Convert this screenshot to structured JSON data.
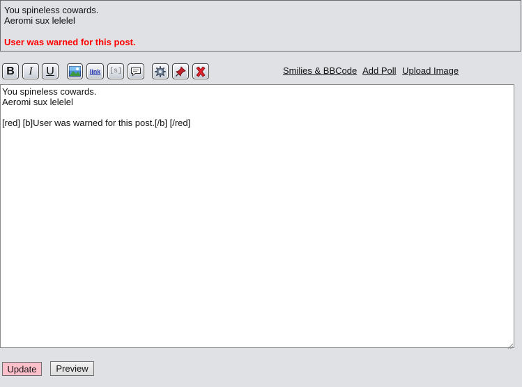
{
  "preview": {
    "line1": "You spineless cowards.",
    "line2": "Aeromi sux lelelel",
    "warning": "User was warned for this post.",
    "warning_color": "#ff0000"
  },
  "toolbar": {
    "bold_label": "B",
    "italic_label": "I",
    "underline_label": "U",
    "link_label": "link",
    "spoiler_label": "[s]",
    "icons": [
      "bold-icon",
      "italic-icon",
      "underline-icon",
      "image-icon",
      "link-icon",
      "spoiler-icon",
      "quote-bubble-icon",
      "gear-icon",
      "pin-icon",
      "delete-x-icon"
    ]
  },
  "links": {
    "smilies": "Smilies & BBCode",
    "add_poll": "Add Poll",
    "upload_image": "Upload Image"
  },
  "editor": {
    "value": "You spineless cowards.\nAeromi sux lelelel\n\n[red] [b]User was warned for this post.[/b] [/red]"
  },
  "actions": {
    "update_label": "Update",
    "update_color": "#ffc0cb",
    "preview_label": "Preview"
  }
}
